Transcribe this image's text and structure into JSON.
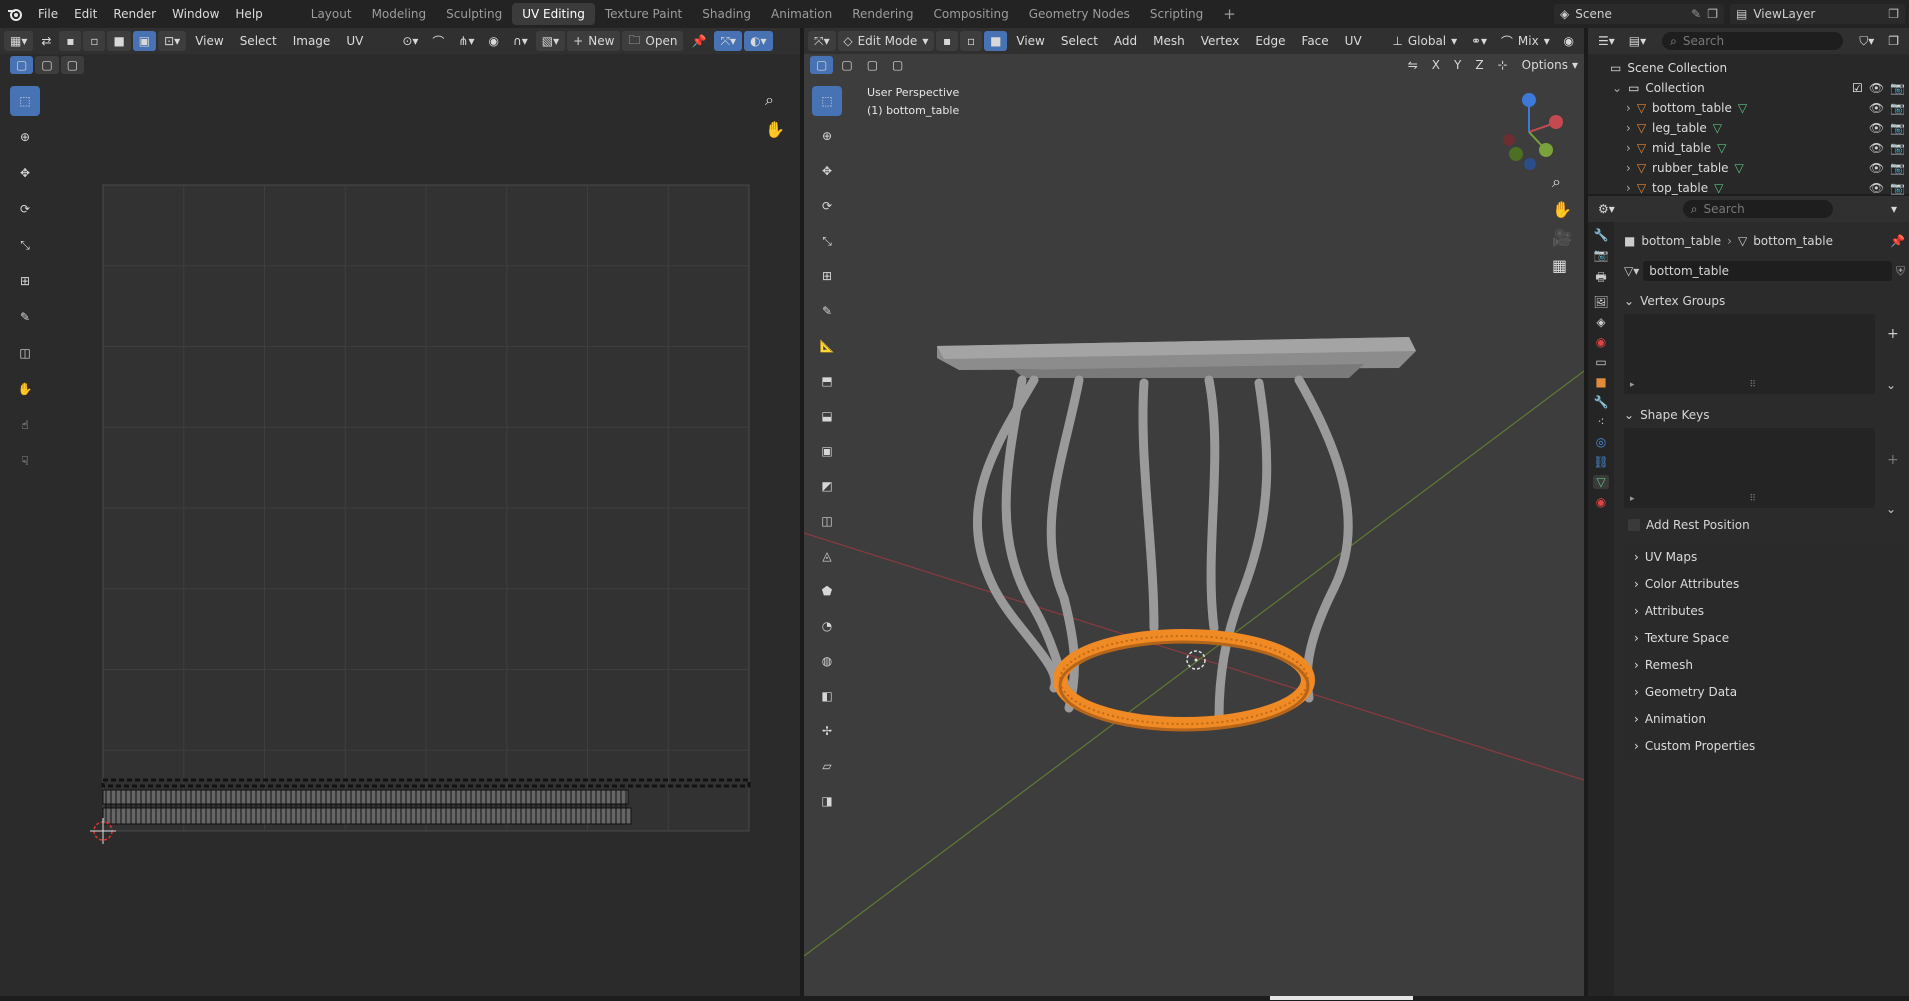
{
  "app": {
    "menu": [
      "File",
      "Edit",
      "Render",
      "Window",
      "Help"
    ],
    "workspaces": [
      "Layout",
      "Modeling",
      "Sculpting",
      "UV Editing",
      "Texture Paint",
      "Shading",
      "Animation",
      "Rendering",
      "Compositing",
      "Geometry Nodes",
      "Scripting"
    ],
    "active_workspace": "UV Editing",
    "add_workspace": "+",
    "scene_label": "Scene",
    "viewlayer_label": "ViewLayer"
  },
  "uv_editor": {
    "menus": [
      "View",
      "Select",
      "Image",
      "UV"
    ],
    "new_label": "New",
    "open_label": "Open"
  },
  "viewport": {
    "mode_label": "Edit Mode",
    "menus": [
      "View",
      "Select",
      "Add",
      "Mesh",
      "Vertex",
      "Edge",
      "Face",
      "UV"
    ],
    "transform_orientation": "Global",
    "snap_mix_label": "Mix",
    "options_label": "Options",
    "axis_x": "X",
    "axis_y": "Y",
    "axis_z": "Z",
    "overlay_line1": "User Perspective",
    "overlay_line2": "(1) bottom_table"
  },
  "outliner": {
    "search_placeholder": "Search",
    "scene_collection": "Scene Collection",
    "collection": "Collection",
    "objects": [
      "bottom_table",
      "leg_table",
      "mid_table",
      "rubber_table",
      "top_table"
    ]
  },
  "properties": {
    "search_placeholder": "Search",
    "breadcrumb_object": "bottom_table",
    "breadcrumb_mesh": "bottom_table",
    "mesh_name": "bottom_table",
    "vertex_groups": "Vertex Groups",
    "shape_keys": "Shape Keys",
    "add_rest_position": "Add Rest Position",
    "sections": [
      "UV Maps",
      "Color Attributes",
      "Attributes",
      "Texture Space",
      "Remesh",
      "Geometry Data",
      "Animation",
      "Custom Properties"
    ]
  },
  "colors": {
    "accent": "#4772b3",
    "selection_orange": "#f08a24",
    "x_axis": "#c44a50",
    "y_axis": "#7aa23a",
    "z_axis": "#3d7ad8"
  }
}
